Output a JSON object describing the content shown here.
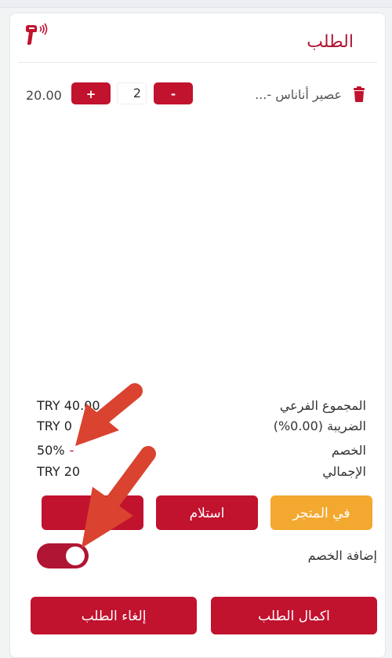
{
  "order": {
    "title": "الطلب",
    "items": [
      {
        "name": "عصير أناناس -...",
        "quantity": "2",
        "price": "20.00",
        "minus_label": "-",
        "plus_label": "+"
      }
    ]
  },
  "summary": {
    "subtotal": {
      "label": "المجموع الفرعي",
      "value": "TRY 40.00"
    },
    "tax": {
      "label": "الضريبة (0.00%)",
      "value": "TRY 0"
    },
    "discount": {
      "label": "الخصم",
      "value": "50%",
      "sign": "-"
    },
    "total": {
      "label": "الإجمالي",
      "value": "TRY 20"
    }
  },
  "order_type": {
    "in_store": "في المتجر",
    "pickup": "استلام",
    "delivery": ""
  },
  "discount_toggle": {
    "label": "إضافة الخصم",
    "on": true
  },
  "actions": {
    "complete": "اكمال الطلب",
    "cancel": "إلغاء الطلب"
  },
  "colors": {
    "primary": "#c1122e",
    "accent": "#f3a830",
    "annotation": "#d9432f"
  },
  "icons": {
    "scanner": "barcode-scanner-icon",
    "trash": "trash-icon"
  }
}
